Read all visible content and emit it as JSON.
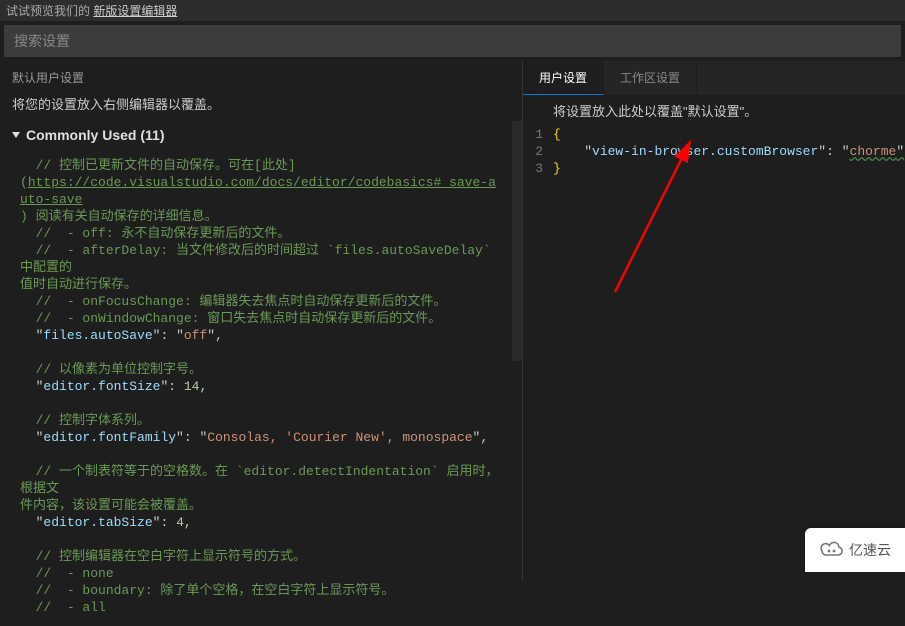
{
  "preview_bar": {
    "prefix": "试试预览我们的 ",
    "link": "新版设置编辑器"
  },
  "search_placeholder": "搜索设置",
  "left": {
    "header": "默认用户设置",
    "desc": "将您的设置放入右侧编辑器以覆盖。",
    "section_title": "Commonly Used (11)",
    "c1a": "  // 控制已更新文件的自动保存。可在[此处]",
    "c1b_open": "(",
    "c1b_url": "https://code.visualstudio.com/docs/editor/codebasics#_save-auto-save",
    "c1c": ") 阅读有关自动保存的详细信息。",
    "c2": "  //  - off: 永不自动保存更新后的文件。",
    "c3a": "  //  - afterDelay: 当文件修改后的时间超过 `files.autoSaveDelay` 中配置的",
    "c3b": "值时自动进行保存。",
    "c4": "  //  - onFocusChange: 编辑器失去焦点时自动保存更新后的文件。",
    "c5": "  //  - onWindowChange: 窗口失去焦点时自动保存更新后的文件。",
    "k1": "files.autoSave",
    "v1": "off",
    "c6": "  // 以像素为单位控制字号。",
    "k2": "editor.fontSize",
    "v2": "14",
    "c7": "  // 控制字体系列。",
    "k3": "editor.fontFamily",
    "v3": "Consolas, 'Courier New', monospace",
    "c8a": "  // 一个制表符等于的空格数。在 `editor.detectIndentation` 启用时，根据文",
    "c8b": "件内容，该设置可能会被覆盖。",
    "k4": "editor.tabSize",
    "v4": "4",
    "c9": "  // 控制编辑器在空白字符上显示符号的方式。",
    "c10": "  //  - none",
    "c11": "  //  - boundary: 除了单个空格，在空白字符上显示符号。",
    "c12": "  //  - all"
  },
  "right": {
    "tab1": "用户设置",
    "tab2": "工作区设置",
    "desc": "将设置放入此处以覆盖\"默认设置\"。",
    "lines": {
      "n1": "1",
      "n2": "2",
      "n3": "3",
      "l1": "{",
      "l2_key": "view-in-browser.customBrowser",
      "l2_val": "chorme",
      "l3": "}"
    }
  },
  "badge": "亿速云"
}
